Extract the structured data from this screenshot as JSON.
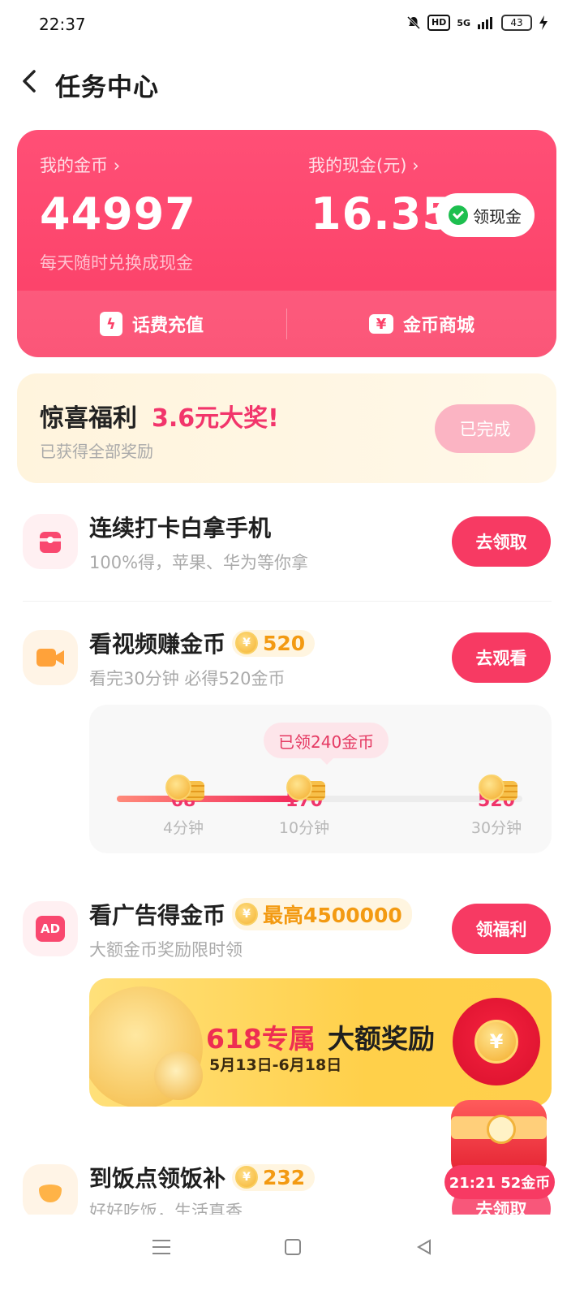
{
  "status": {
    "time": "22:37",
    "network": "5G",
    "hd": "HD",
    "battery": "43"
  },
  "header": {
    "title": "任务中心"
  },
  "wallet": {
    "coins_label": "我的金币",
    "coins_value": "44997",
    "coins_sub": "每天随时兑换成现金",
    "cash_label": "我的现金(元)",
    "cash_value": "16.35",
    "cash_button": "领现金",
    "action_recharge": "话费充值",
    "action_mall": "金币商城",
    "accent": "#fb3f66"
  },
  "surprise": {
    "title": "惊喜福利",
    "accent": "3.6元大奖!",
    "sub": "已获得全部奖励",
    "button": "已完成"
  },
  "tasks": [
    {
      "title": "连续打卡白拿手机",
      "sub": "100%得，苹果、华为等你拿",
      "button": "去领取",
      "icon": "gift-box-icon"
    },
    {
      "title": "看视频赚金币",
      "coin": "520",
      "sub": "看完30分钟 必得520金币",
      "button": "去观看",
      "icon": "video-camera-icon"
    },
    {
      "title": "看广告得金币",
      "coin": "最高4500000",
      "sub": "大额金币奖励限时领",
      "button": "领福利",
      "icon": "ad-icon",
      "icon_text": "AD"
    },
    {
      "title": "到饭点领饭补",
      "coin": "232",
      "sub": "好好吃饭，生活真香",
      "button": "去领取",
      "icon": "meal-icon"
    }
  ],
  "video_progress": {
    "tooltip": "已领240金币",
    "fraction": 0.45,
    "milestones": [
      {
        "value": "68",
        "time": "4分钟"
      },
      {
        "value": "170",
        "time": "10分钟"
      },
      {
        "value": "520",
        "time": "30分钟"
      }
    ]
  },
  "promo": {
    "title_red": "618专属",
    "title_dark": "大额奖励",
    "date": "5月13日-6月18日"
  },
  "float_reward": {
    "timer": "21:21 52金币"
  },
  "coin_symbol": "¥"
}
